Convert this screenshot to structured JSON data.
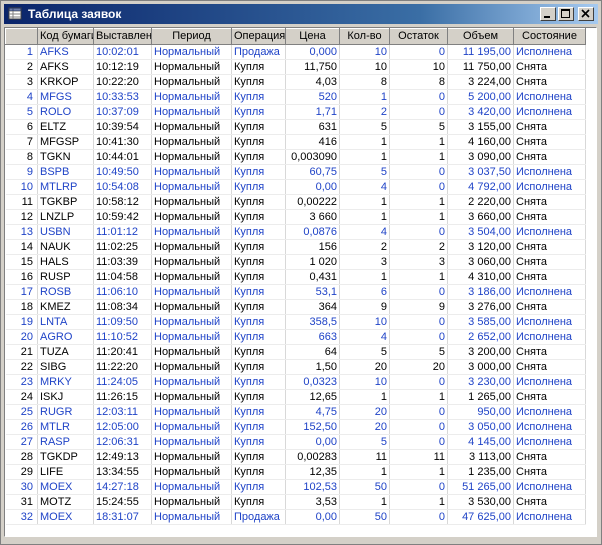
{
  "window": {
    "title": "Таблица заявок"
  },
  "columns": [
    "",
    "Код бумаги",
    "Выставлена",
    "Период",
    "Операция",
    "Цена",
    "Кол-во",
    "Остаток",
    "Объем",
    "Состояние"
  ],
  "rows": [
    {
      "n": "1",
      "code": "AFKS",
      "time": "10:02:01",
      "period": "Нормальный",
      "op": "Продажа",
      "price": "0,000",
      "qty": "10",
      "rest": "0",
      "vol": "11 195,00",
      "state": "Исполнена",
      "color": "blue"
    },
    {
      "n": "2",
      "code": "AFKS",
      "time": "10:12:19",
      "period": "Нормальный",
      "op": "Купля",
      "price": "11,750",
      "qty": "10",
      "rest": "10",
      "vol": "11 750,00",
      "state": "Снята",
      "color": "black"
    },
    {
      "n": "3",
      "code": "KRKOP",
      "time": "10:22:20",
      "period": "Нормальный",
      "op": "Купля",
      "price": "4,03",
      "qty": "8",
      "rest": "8",
      "vol": "3 224,00",
      "state": "Снята",
      "color": "black"
    },
    {
      "n": "4",
      "code": "MFGS",
      "time": "10:33:53",
      "period": "Нормальный",
      "op": "Купля",
      "price": "520",
      "qty": "1",
      "rest": "0",
      "vol": "5 200,00",
      "state": "Исполнена",
      "color": "blue"
    },
    {
      "n": "5",
      "code": "ROLO",
      "time": "10:37:09",
      "period": "Нормальный",
      "op": "Купля",
      "price": "1,71",
      "qty": "2",
      "rest": "0",
      "vol": "3 420,00",
      "state": "Исполнена",
      "color": "blue"
    },
    {
      "n": "6",
      "code": "ELTZ",
      "time": "10:39:54",
      "period": "Нормальный",
      "op": "Купля",
      "price": "631",
      "qty": "5",
      "rest": "5",
      "vol": "3 155,00",
      "state": "Снята",
      "color": "black"
    },
    {
      "n": "7",
      "code": "MFGSP",
      "time": "10:41:30",
      "period": "Нормальный",
      "op": "Купля",
      "price": "416",
      "qty": "1",
      "rest": "1",
      "vol": "4 160,00",
      "state": "Снята",
      "color": "black"
    },
    {
      "n": "8",
      "code": "TGKN",
      "time": "10:44:01",
      "period": "Нормальный",
      "op": "Купля",
      "price": "0,003090",
      "qty": "1",
      "rest": "1",
      "vol": "3 090,00",
      "state": "Снята",
      "color": "black"
    },
    {
      "n": "9",
      "code": "BSPB",
      "time": "10:49:50",
      "period": "Нормальный",
      "op": "Купля",
      "price": "60,75",
      "qty": "5",
      "rest": "0",
      "vol": "3 037,50",
      "state": "Исполнена",
      "color": "blue"
    },
    {
      "n": "10",
      "code": "MTLRP",
      "time": "10:54:08",
      "period": "Нормальный",
      "op": "Купля",
      "price": "0,00",
      "qty": "4",
      "rest": "0",
      "vol": "4 792,00",
      "state": "Исполнена",
      "color": "blue"
    },
    {
      "n": "11",
      "code": "TGKBP",
      "time": "10:58:12",
      "period": "Нормальный",
      "op": "Купля",
      "price": "0,00222",
      "qty": "1",
      "rest": "1",
      "vol": "2 220,00",
      "state": "Снята",
      "color": "black"
    },
    {
      "n": "12",
      "code": "LNZLP",
      "time": "10:59:42",
      "period": "Нормальный",
      "op": "Купля",
      "price": "3 660",
      "qty": "1",
      "rest": "1",
      "vol": "3 660,00",
      "state": "Снята",
      "color": "black"
    },
    {
      "n": "13",
      "code": "USBN",
      "time": "11:01:12",
      "period": "Нормальный",
      "op": "Купля",
      "price": "0,0876",
      "qty": "4",
      "rest": "0",
      "vol": "3 504,00",
      "state": "Исполнена",
      "color": "blue"
    },
    {
      "n": "14",
      "code": "NAUK",
      "time": "11:02:25",
      "period": "Нормальный",
      "op": "Купля",
      "price": "156",
      "qty": "2",
      "rest": "2",
      "vol": "3 120,00",
      "state": "Снята",
      "color": "black"
    },
    {
      "n": "15",
      "code": "HALS",
      "time": "11:03:39",
      "period": "Нормальный",
      "op": "Купля",
      "price": "1 020",
      "qty": "3",
      "rest": "3",
      "vol": "3 060,00",
      "state": "Снята",
      "color": "black"
    },
    {
      "n": "16",
      "code": "RUSP",
      "time": "11:04:58",
      "period": "Нормальный",
      "op": "Купля",
      "price": "0,431",
      "qty": "1",
      "rest": "1",
      "vol": "4 310,00",
      "state": "Снята",
      "color": "black"
    },
    {
      "n": "17",
      "code": "ROSB",
      "time": "11:06:10",
      "period": "Нормальный",
      "op": "Купля",
      "price": "53,1",
      "qty": "6",
      "rest": "0",
      "vol": "3 186,00",
      "state": "Исполнена",
      "color": "blue"
    },
    {
      "n": "18",
      "code": "KMEZ",
      "time": "11:08:34",
      "period": "Нормальный",
      "op": "Купля",
      "price": "364",
      "qty": "9",
      "rest": "9",
      "vol": "3 276,00",
      "state": "Снята",
      "color": "black"
    },
    {
      "n": "19",
      "code": "LNTA",
      "time": "11:09:50",
      "period": "Нормальный",
      "op": "Купля",
      "price": "358,5",
      "qty": "10",
      "rest": "0",
      "vol": "3 585,00",
      "state": "Исполнена",
      "color": "blue"
    },
    {
      "n": "20",
      "code": "AGRO",
      "time": "11:10:52",
      "period": "Нормальный",
      "op": "Купля",
      "price": "663",
      "qty": "4",
      "rest": "0",
      "vol": "2 652,00",
      "state": "Исполнена",
      "color": "blue"
    },
    {
      "n": "21",
      "code": "TUZA",
      "time": "11:20:41",
      "period": "Нормальный",
      "op": "Купля",
      "price": "64",
      "qty": "5",
      "rest": "5",
      "vol": "3 200,00",
      "state": "Снята",
      "color": "black"
    },
    {
      "n": "22",
      "code": "SIBG",
      "time": "11:22:20",
      "period": "Нормальный",
      "op": "Купля",
      "price": "1,50",
      "qty": "20",
      "rest": "20",
      "vol": "3 000,00",
      "state": "Снята",
      "color": "black"
    },
    {
      "n": "23",
      "code": "MRKY",
      "time": "11:24:05",
      "period": "Нормальный",
      "op": "Купля",
      "price": "0,0323",
      "qty": "10",
      "rest": "0",
      "vol": "3 230,00",
      "state": "Исполнена",
      "color": "blue"
    },
    {
      "n": "24",
      "code": "ISKJ",
      "time": "11:26:15",
      "period": "Нормальный",
      "op": "Купля",
      "price": "12,65",
      "qty": "1",
      "rest": "1",
      "vol": "1 265,00",
      "state": "Снята",
      "color": "black"
    },
    {
      "n": "25",
      "code": "RUGR",
      "time": "12:03:11",
      "period": "Нормальный",
      "op": "Купля",
      "price": "4,75",
      "qty": "20",
      "rest": "0",
      "vol": "950,00",
      "state": "Исполнена",
      "color": "blue"
    },
    {
      "n": "26",
      "code": "MTLR",
      "time": "12:05:00",
      "period": "Нормальный",
      "op": "Купля",
      "price": "152,50",
      "qty": "20",
      "rest": "0",
      "vol": "3 050,00",
      "state": "Исполнена",
      "color": "blue"
    },
    {
      "n": "27",
      "code": "RASP",
      "time": "12:06:31",
      "period": "Нормальный",
      "op": "Купля",
      "price": "0,00",
      "qty": "5",
      "rest": "0",
      "vol": "4 145,00",
      "state": "Исполнена",
      "color": "blue"
    },
    {
      "n": "28",
      "code": "TGKDP",
      "time": "12:49:13",
      "period": "Нормальный",
      "op": "Купля",
      "price": "0,00283",
      "qty": "11",
      "rest": "11",
      "vol": "3 113,00",
      "state": "Снята",
      "color": "black"
    },
    {
      "n": "29",
      "code": "LIFE",
      "time": "13:34:55",
      "period": "Нормальный",
      "op": "Купля",
      "price": "12,35",
      "qty": "1",
      "rest": "1",
      "vol": "1 235,00",
      "state": "Снята",
      "color": "black"
    },
    {
      "n": "30",
      "code": "MOEX",
      "time": "14:27:18",
      "period": "Нормальный",
      "op": "Купля",
      "price": "102,53",
      "qty": "50",
      "rest": "0",
      "vol": "51 265,00",
      "state": "Исполнена",
      "color": "blue"
    },
    {
      "n": "31",
      "code": "MOTZ",
      "time": "15:24:55",
      "period": "Нормальный",
      "op": "Купля",
      "price": "3,53",
      "qty": "1",
      "rest": "1",
      "vol": "3 530,00",
      "state": "Снята",
      "color": "black"
    },
    {
      "n": "32",
      "code": "MOEX",
      "time": "18:31:07",
      "period": "Нормальный",
      "op": "Продажа",
      "price": "0,00",
      "qty": "50",
      "rest": "0",
      "vol": "47 625,00",
      "state": "Исполнена",
      "color": "blue"
    }
  ]
}
